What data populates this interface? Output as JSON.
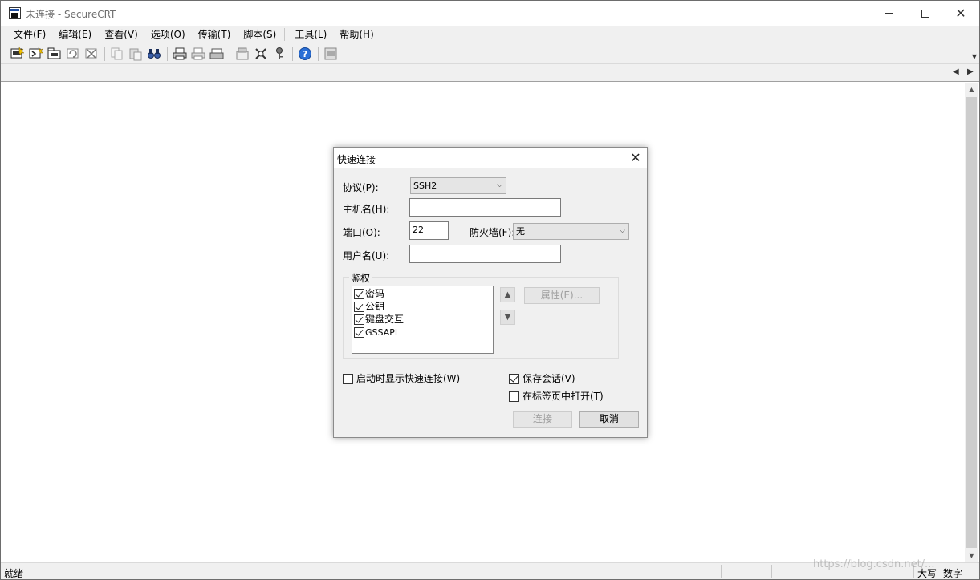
{
  "window": {
    "title": "未连接 - SecureCRT"
  },
  "menu": [
    {
      "label": "文件(F)"
    },
    {
      "label": "编辑(E)"
    },
    {
      "label": "查看(V)"
    },
    {
      "label": "选项(O)"
    },
    {
      "label": "传输(T)"
    },
    {
      "label": "脚本(S)"
    },
    {
      "label": "工具(L)"
    },
    {
      "label": "帮助(H)"
    }
  ],
  "toolbar": {
    "icons": [
      "connect-icon",
      "quick-connect-icon",
      "connect-in-tab-icon",
      "reconnect-icon",
      "disconnect-icon",
      "copy-icon",
      "paste-icon",
      "find-icon",
      "print-icon",
      "print-selection-icon",
      "print-setup-icon",
      "session-options-icon",
      "global-options-icon",
      "keymap-icon",
      "help-icon",
      "map-keys-icon"
    ]
  },
  "dialog": {
    "title": "快速连接",
    "protocol_label": "协议(P):",
    "protocol_value": "SSH2",
    "hostname_label": "主机名(H):",
    "hostname_value": "",
    "port_label": "端口(O):",
    "port_value": "22",
    "firewall_label": "防火墙(F):",
    "firewall_value": "无",
    "username_label": "用户名(U):",
    "username_value": "",
    "auth_group_label": "鉴权",
    "auth_methods": [
      {
        "label": "密码",
        "checked": true
      },
      {
        "label": "公钥",
        "checked": true
      },
      {
        "label": "键盘交互",
        "checked": true
      },
      {
        "label": "GSSAPI",
        "checked": true
      }
    ],
    "properties_button": "属性(E)...",
    "show_on_startup_label": "启动时显示快速连接(W)",
    "show_on_startup_checked": false,
    "save_session_label": "保存会话(V)",
    "save_session_checked": true,
    "open_in_tab_label": "在标签页中打开(T)",
    "open_in_tab_checked": false,
    "connect_button": "连接",
    "cancel_button": "取消"
  },
  "status": {
    "text": "就绪",
    "caps": "大写",
    "num": "数字"
  },
  "watermark": "https://blog.csdn.net/..."
}
